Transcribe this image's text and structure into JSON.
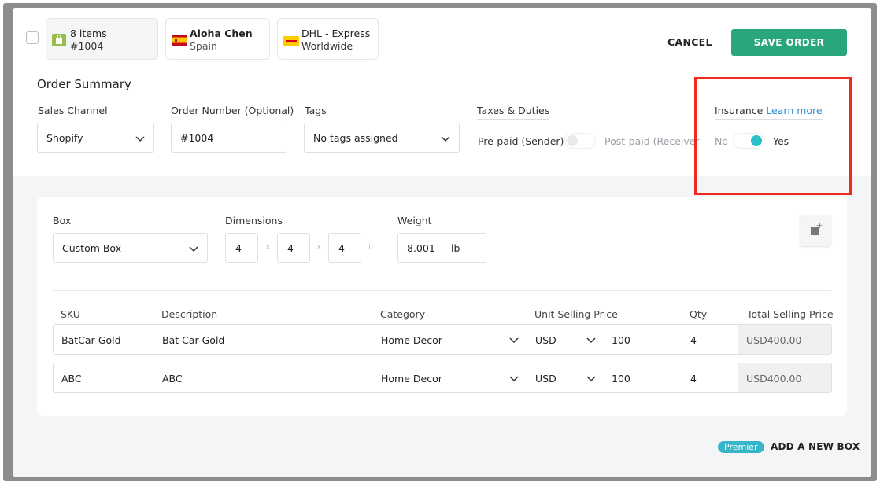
{
  "header": {
    "chips": [
      {
        "line1": "8 items",
        "line2": "#1004"
      },
      {
        "line1": "Aloha Chen",
        "line2": "Spain"
      },
      {
        "line1": "DHL - Express",
        "line2": "Worldwide"
      }
    ],
    "cancel_label": "CANCEL",
    "save_label": "SAVE ORDER"
  },
  "summary": {
    "title": "Order Summary",
    "sales_channel": {
      "label": "Sales Channel",
      "value": "Shopify"
    },
    "order_number": {
      "label": "Order Number (Optional)",
      "value": "#1004"
    },
    "tags": {
      "label": "Tags",
      "value": "No tags assigned"
    },
    "taxes": {
      "label": "Taxes & Duties",
      "option_left": "Pre-paid (Sender)",
      "option_right": "Post-paid (Receiver"
    },
    "insurance": {
      "label": "Insurance",
      "link": "Learn more",
      "option_left": "No",
      "option_right": "Yes"
    }
  },
  "box": {
    "box_label": "Box",
    "box_value": "Custom Box",
    "dimensions_label": "Dimensions",
    "dims": [
      "4",
      "4",
      "4"
    ],
    "sep": "x",
    "unit": "in",
    "weight_label": "Weight",
    "weight_value": "8.001",
    "weight_unit": "lb"
  },
  "table": {
    "headers": [
      "SKU",
      "Description",
      "Category",
      "Unit Selling Price",
      "Qty",
      "Total Selling Price"
    ],
    "rows": [
      {
        "sku": "BatCar-Gold",
        "description": "Bat Car Gold",
        "category": "Home Decor",
        "currency": "USD",
        "price": "100",
        "qty": "4",
        "total": "USD400.00"
      },
      {
        "sku": "ABC",
        "description": "ABC",
        "category": "Home Decor",
        "currency": "USD",
        "price": "100",
        "qty": "4",
        "total": "USD400.00"
      }
    ]
  },
  "footer": {
    "premier_badge": "Premier",
    "add_box_label": "ADD A NEW BOX"
  },
  "colors": {
    "primary_green": "#2aa77a",
    "toggle_teal": "#2bbfc9",
    "highlight_red": "#ef2b1d",
    "link_blue": "#2f8fd6"
  }
}
